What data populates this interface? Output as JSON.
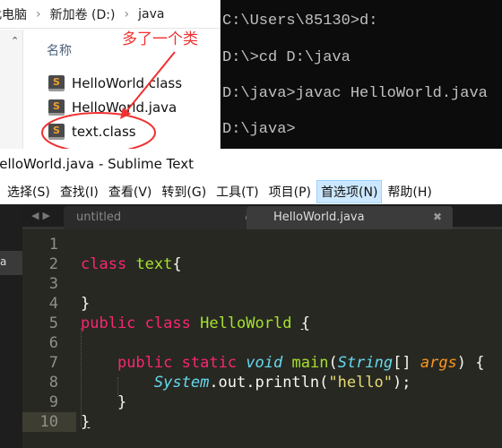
{
  "explorer": {
    "breadcrumb": [
      "此电脑",
      "新加卷 (D:)",
      "java"
    ],
    "column_header": "名称",
    "files": [
      "HelloWorld.class",
      "HelloWorld.java",
      "text.class"
    ],
    "file_icon_letter": "S"
  },
  "annotation": {
    "text": "多了一个类",
    "color": "#f03030"
  },
  "cmd": {
    "lines": [
      "C:\\Users\\85130>d:",
      "D:\\>cd D:\\java",
      "D:\\java>javac HelloWorld.java",
      "D:\\java>"
    ]
  },
  "sublime": {
    "title": "HelloWorld.java - Sublime Text",
    "menu": [
      "选择(S)",
      "查找(I)",
      "查看(V)",
      "转到(G)",
      "工具(T)",
      "项目(P)",
      "首选项(N)",
      "帮助(H)"
    ],
    "sidebar_selected": "a",
    "tabs": [
      {
        "label": "untitled",
        "modified": true,
        "active": false
      },
      {
        "label": "HelloWorld.java",
        "active": true
      }
    ],
    "current_line": 10,
    "line_numbers": [
      "1",
      "2",
      "3",
      "4",
      "5",
      "6",
      "7",
      "8",
      "9",
      "10"
    ]
  }
}
